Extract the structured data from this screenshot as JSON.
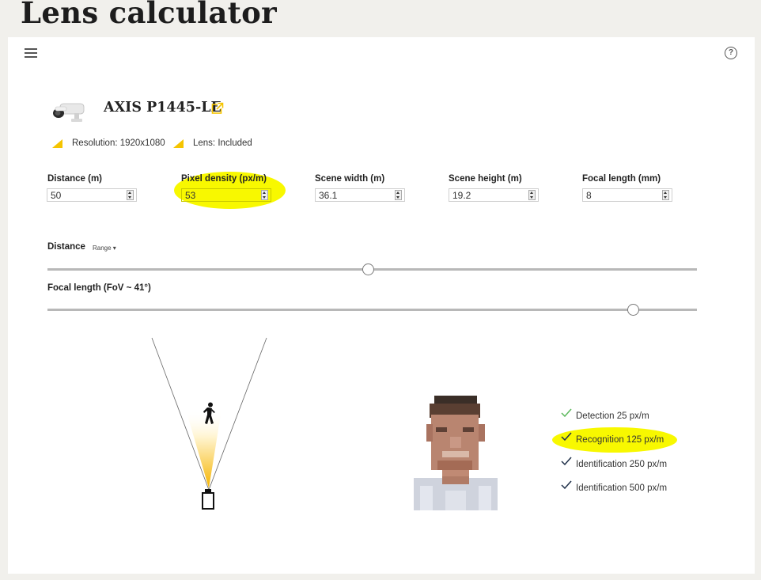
{
  "page": {
    "heading": "Lens calculator"
  },
  "toolbar": {
    "menu_icon": "hamburger-menu-icon",
    "help_icon": "question-circle-icon",
    "help_glyph": "?"
  },
  "product": {
    "name": "AXIS P1445-LE",
    "image_icon": "bullet-camera-icon",
    "link_icon": "external-link-icon",
    "specs": [
      "Resolution: 1920x1080",
      "Lens: Included"
    ],
    "accent_color": "#f5c400"
  },
  "fields": [
    {
      "label": "Distance (m)",
      "value": "50"
    },
    {
      "label": "Pixel density (px/m)",
      "value": "53"
    },
    {
      "label": "Scene width (m)",
      "value": "36.1"
    },
    {
      "label": "Scene height (m)",
      "value": "19.2"
    },
    {
      "label": "Focal length (mm)",
      "value": "8"
    }
  ],
  "sliders": {
    "distance": {
      "label": "Distance",
      "range_button": "Range ▾",
      "position": 0.5
    },
    "focal": {
      "label": "Focal length (FoV ~ 41°)",
      "position": 0.9
    }
  },
  "fov": {
    "person_icon": "walking-person-icon",
    "camera_icon": "camera-icon"
  },
  "preview": {
    "icon": "pixelated-face-image"
  },
  "levels": [
    {
      "label": "Detection 25 px/m",
      "check_color": "#5cb85c"
    },
    {
      "label": "Recognition 125 px/m",
      "check_color": "#1f3049"
    },
    {
      "label": "Identification 250 px/m",
      "check_color": "#1f3049"
    },
    {
      "label": "Identification 500 px/m",
      "check_color": "#1f3049"
    }
  ],
  "highlight_color": "#f8f800"
}
